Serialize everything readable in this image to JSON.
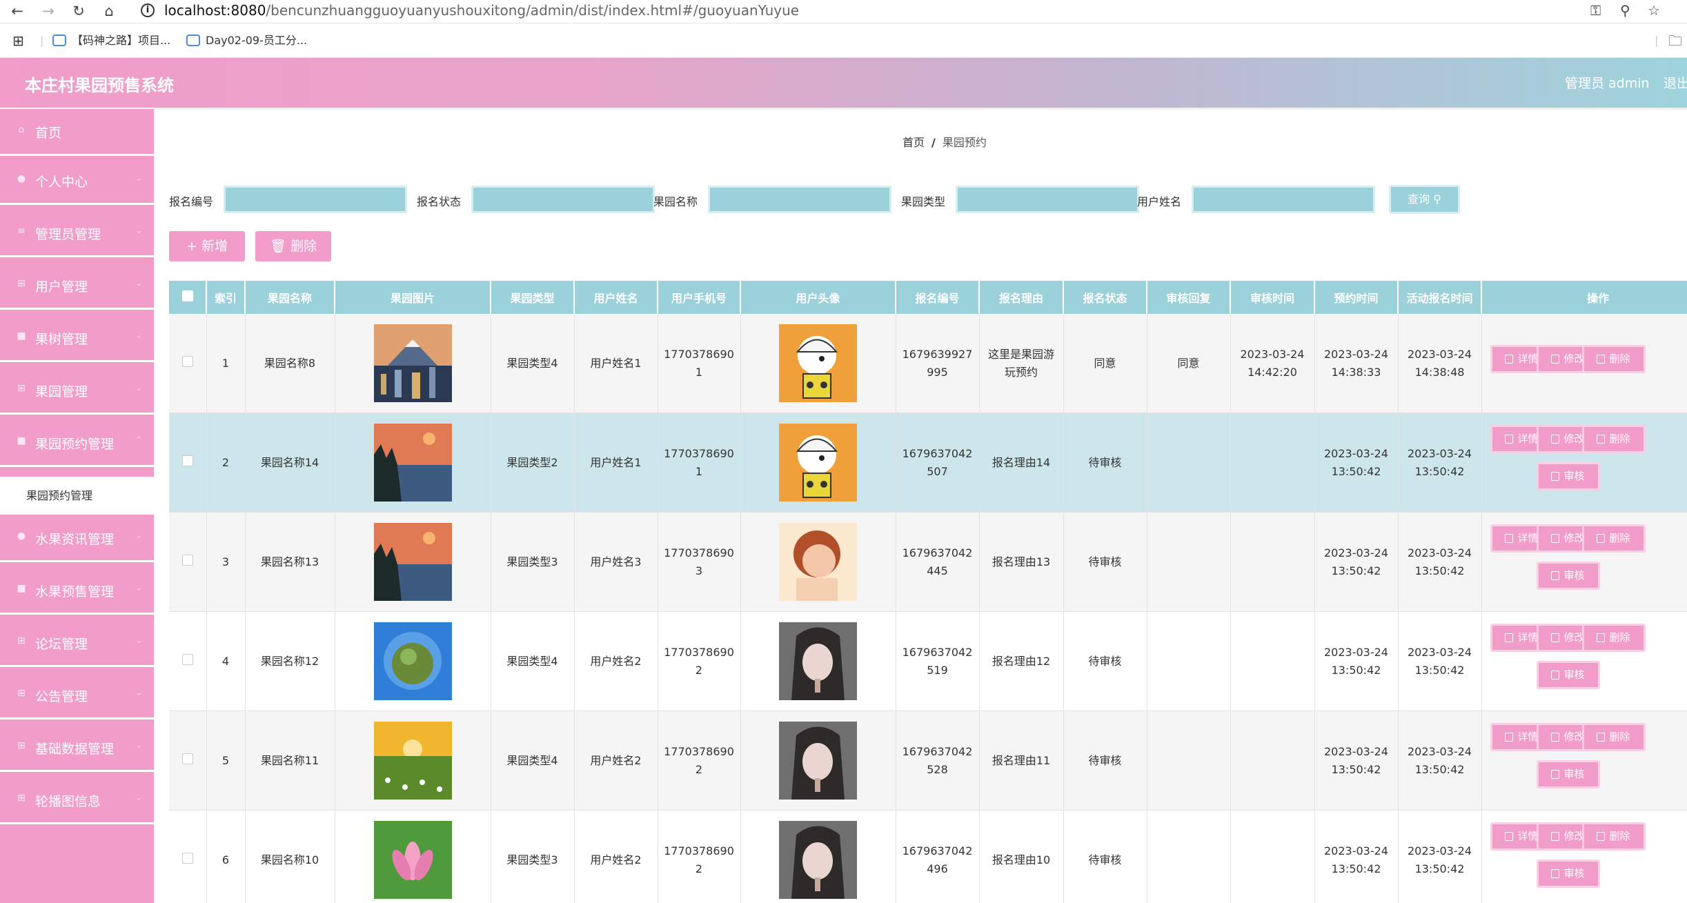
{
  "browser": {
    "url_host": "localhost:8080",
    "url_path": "/bencunzhuangguoyuanyushouxitong/admin/dist/index.html#/guoyuanYuyue",
    "bookmarks": [
      "【码神之路】项目...",
      "Day02-09-员工分..."
    ]
  },
  "header": {
    "title": "本庄村果园预售系统",
    "admin_label": "管理员 admin",
    "logout": "退出"
  },
  "sidebar": {
    "items": [
      {
        "label": "首页",
        "icon": "home-icon"
      },
      {
        "label": "个人中心",
        "icon": "user-icon"
      },
      {
        "label": "管理员管理",
        "icon": "list-icon"
      },
      {
        "label": "用户管理",
        "icon": "grid-icon"
      },
      {
        "label": "果树管理",
        "icon": "chat-icon"
      },
      {
        "label": "果园管理",
        "icon": "grid-icon"
      },
      {
        "label": "果园预约管理",
        "icon": "chat-icon"
      },
      {
        "label": "水果资讯管理",
        "icon": "user-icon"
      },
      {
        "label": "水果预售管理",
        "icon": "chat-icon"
      },
      {
        "label": "论坛管理",
        "icon": "grid-icon"
      },
      {
        "label": "公告管理",
        "icon": "grid-icon"
      },
      {
        "label": "基础数据管理",
        "icon": "grid-icon"
      },
      {
        "label": "轮播图信息",
        "icon": "grid-icon"
      }
    ],
    "active_sub": "果园预约管理"
  },
  "breadcrumb": {
    "home": "首页",
    "separator": "/",
    "current": "果园预约"
  },
  "filters": {
    "labels": [
      "报名编号",
      "报名状态",
      "果园名称",
      "果园类型",
      "用户姓名"
    ],
    "query": "查询"
  },
  "toolbar": {
    "add": "新增",
    "delete": "删除"
  },
  "table": {
    "headers": [
      "索引",
      "果园名称",
      "果园图片",
      "果园类型",
      "用户姓名",
      "用户手机号",
      "用户头像",
      "报名编号",
      "报名理由",
      "报名状态",
      "审核回复",
      "审核时间",
      "预约时间",
      "活动报名时间",
      "操作"
    ],
    "rows": [
      {
        "idx": "1",
        "name": "果园名称8",
        "type": "果园类型4",
        "user": "用户姓名1",
        "phone1": "1770378690",
        "phone2": "1",
        "no1": "1679639927",
        "no2": "995",
        "reason": "这里是果园游玩预约",
        "status": "同意",
        "reply": "同意",
        "audit1": "2023-03-24",
        "audit2": "14:42:20",
        "appt1": "2023-03-24",
        "appt2": "14:38:33",
        "act1": "2023-03-24",
        "act2": "14:38:48"
      },
      {
        "idx": "2",
        "name": "果园名称14",
        "type": "果园类型2",
        "user": "用户姓名1",
        "phone1": "1770378690",
        "phone2": "1",
        "no1": "1679637042",
        "no2": "507",
        "reason": "报名理由14",
        "status": "待审核",
        "reply": "",
        "audit1": "",
        "audit2": "",
        "appt1": "2023-03-24",
        "appt2": "13:50:42",
        "act1": "2023-03-24",
        "act2": "13:50:42"
      },
      {
        "idx": "3",
        "name": "果园名称13",
        "type": "果园类型3",
        "user": "用户姓名3",
        "phone1": "1770378690",
        "phone2": "3",
        "no1": "1679637042",
        "no2": "445",
        "reason": "报名理由13",
        "status": "待审核",
        "reply": "",
        "audit1": "",
        "audit2": "",
        "appt1": "2023-03-24",
        "appt2": "13:50:42",
        "act1": "2023-03-24",
        "act2": "13:50:42"
      },
      {
        "idx": "4",
        "name": "果园名称12",
        "type": "果园类型4",
        "user": "用户姓名2",
        "phone1": "1770378690",
        "phone2": "2",
        "no1": "1679637042",
        "no2": "519",
        "reason": "报名理由12",
        "status": "待审核",
        "reply": "",
        "audit1": "",
        "audit2": "",
        "appt1": "2023-03-24",
        "appt2": "13:50:42",
        "act1": "2023-03-24",
        "act2": "13:50:42"
      },
      {
        "idx": "5",
        "name": "果园名称11",
        "type": "果园类型4",
        "user": "用户姓名2",
        "phone1": "1770378690",
        "phone2": "2",
        "no1": "1679637042",
        "no2": "528",
        "reason": "报名理由11",
        "status": "待审核",
        "reply": "",
        "audit1": "",
        "audit2": "",
        "appt1": "2023-03-24",
        "appt2": "13:50:42",
        "act1": "2023-03-24",
        "act2": "13:50:42"
      },
      {
        "idx": "6",
        "name": "果园名称10",
        "type": "果园类型3",
        "user": "用户姓名2",
        "phone1": "1770378690",
        "phone2": "2",
        "no1": "1679637042",
        "no2": "496",
        "reason": "报名理由10",
        "status": "待审核",
        "reply": "",
        "audit1": "",
        "audit2": "",
        "appt1": "2023-03-24",
        "appt2": "13:50:42",
        "act1": "2023-03-24",
        "act2": "13:50:42"
      }
    ],
    "ops": {
      "detail": "详情",
      "edit": "修改",
      "delete": "删除",
      "audit": "审核"
    }
  }
}
